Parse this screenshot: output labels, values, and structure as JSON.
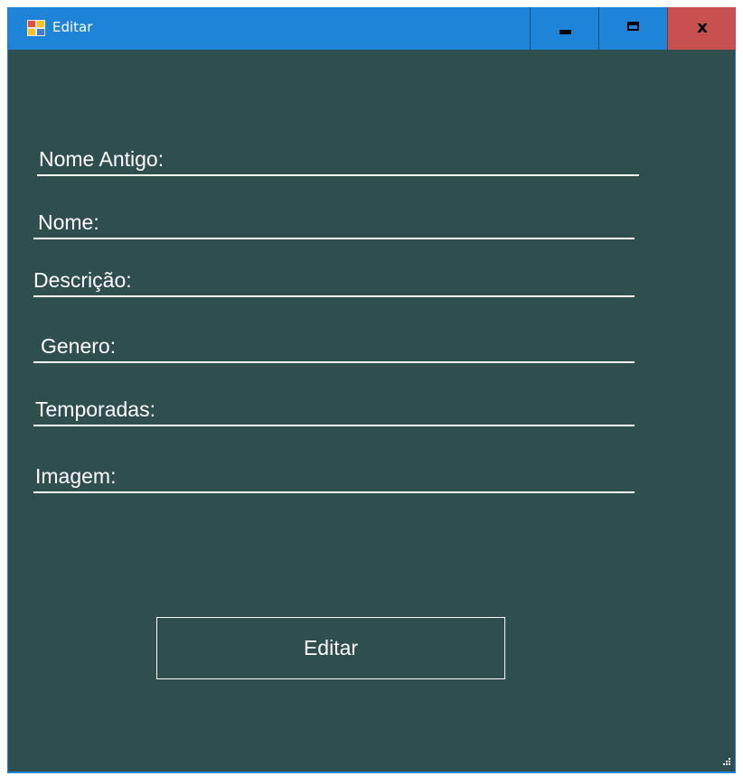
{
  "window": {
    "title": "Editar",
    "icon": "app-form-icon",
    "controls": {
      "minimize_icon": "minimize-icon",
      "maximize_icon": "maximize-icon",
      "close_label": "x"
    }
  },
  "form": {
    "fields": [
      {
        "label": "Nome Antigo:",
        "value": ""
      },
      {
        "label": "Nome:",
        "value": ""
      },
      {
        "label": "Descrição:",
        "value": ""
      },
      {
        "label": "Genero:",
        "value": ""
      },
      {
        "label": "Temporadas:",
        "value": ""
      },
      {
        "label": "Imagem:",
        "value": ""
      }
    ],
    "submit_label": "Editar"
  },
  "colors": {
    "titlebar": "#1e84d8",
    "client_background": "#2f4f4f",
    "close_button": "#c75050",
    "foreground": "#ffffff"
  }
}
